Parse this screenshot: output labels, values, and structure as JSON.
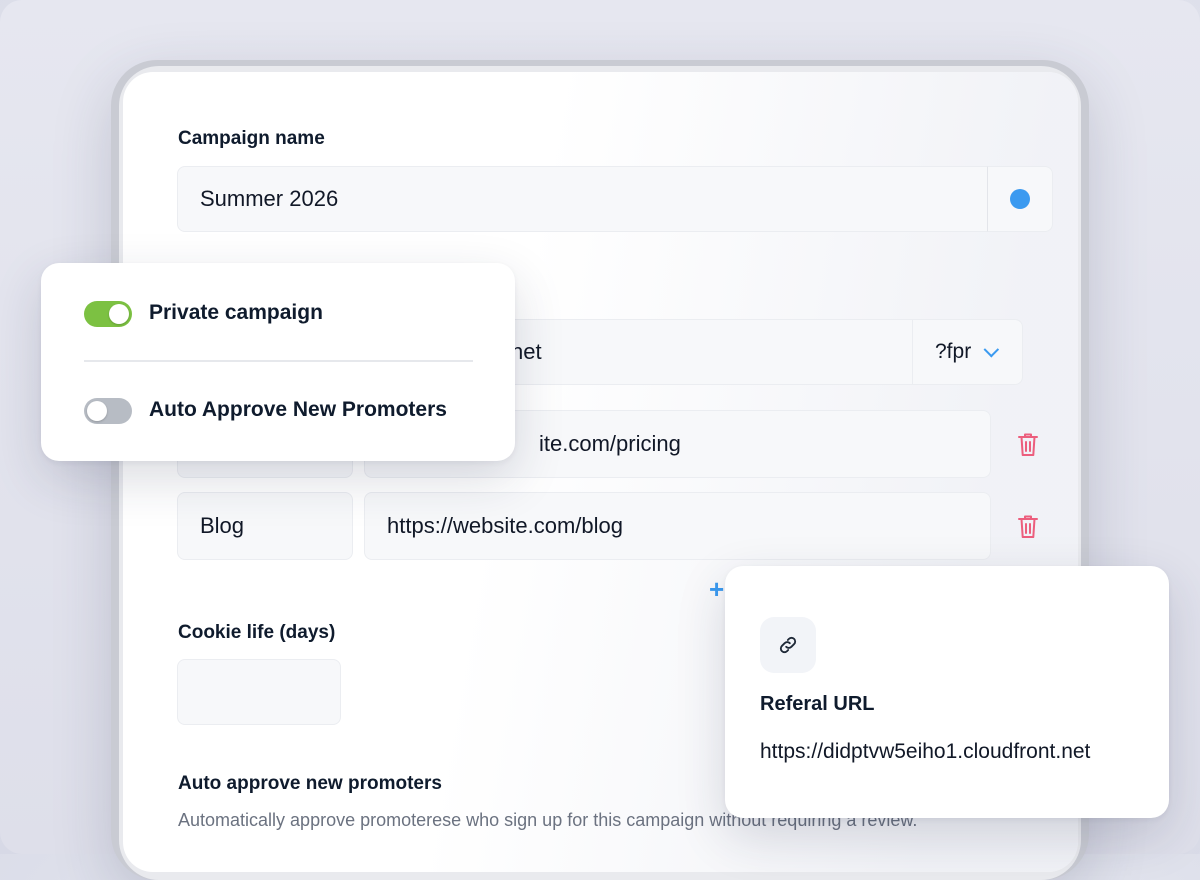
{
  "campaign": {
    "name_label": "Campaign name",
    "name_value": "Summer 2026",
    "color": "#3b9af0"
  },
  "url": {
    "domain_fragment": "net",
    "param_selected": "?fpr"
  },
  "links": [
    {
      "label": "",
      "url": "ite.com/pricing"
    },
    {
      "label": "Blog",
      "url": "https://website.com/blog"
    }
  ],
  "add_link_icon": "plus-icon",
  "cookie": {
    "label": "Cookie life (days)",
    "value": ""
  },
  "auto_approve_section": {
    "title": "Auto approve new promoters",
    "description": "Automatically approve promoterese who sign up for this campaign without requiring a review."
  },
  "toggles": {
    "private_label": "Private campaign",
    "private_on": true,
    "auto_label": "Auto Approve New Promoters",
    "auto_on": false,
    "on_color": "#7cc142"
  },
  "referral": {
    "icon": "link-icon",
    "title": "Referal URL",
    "url": "https://didptvw5eiho1.cloudfront.net"
  }
}
